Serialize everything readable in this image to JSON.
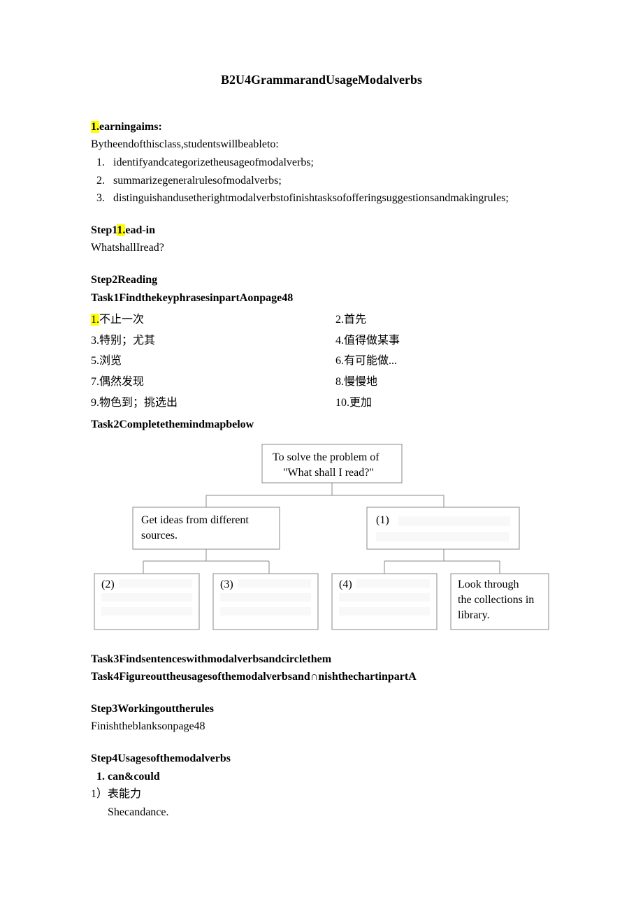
{
  "title": "B2U4GrammarandUsageModalverbs",
  "learning_aims": {
    "head_prefix": "1.",
    "head_rest": "earningaims:",
    "intro": "Bytheendofthisclass,studentswillbeableto:",
    "items": [
      "identifyandcategorizetheusageofmodalverbs;",
      "summarizegeneralrulesofmodalverbs;",
      "distinguishandusetherightmodalverbstofinishtasksofofferingsuggestionsandmakingrules;"
    ]
  },
  "step1": {
    "head_prefix": "Step1",
    "head_hl": "1.",
    "head_rest": "ead-in",
    "body": "WhatshallIread?"
  },
  "step2": {
    "head": "Step2Reading",
    "task1_head": "Task1FindthekeyphrasesinpartAonpage48",
    "phrases": [
      {
        "n_hl": "1.",
        "left": "不止一次",
        "right": "2.首先"
      },
      {
        "n_hl": "",
        "left": "3.特别；尤其",
        "right": "4.值得做某事"
      },
      {
        "n_hl": "",
        "left": "5.浏览",
        "right": "6.有可能做..."
      },
      {
        "n_hl": "",
        "left": "7.偶然发现",
        "right": "8.慢慢地"
      },
      {
        "n_hl": "",
        "left": "9.物色到；挑选出",
        "right": "10.更加"
      }
    ],
    "task2_head": "Task2Completethemindmapbelow",
    "mindmap": {
      "root_l1": "To solve the problem of",
      "root_l2": "\"What shall I read?\"",
      "left_l1": "Get ideas from different",
      "left_l2": "sources.",
      "right": "(1)",
      "b2": "(2)",
      "b3": "(3)",
      "b4": "(4)",
      "b5_l1": "Look through",
      "b5_l2": "the collections in",
      "b5_l3": "library."
    },
    "task3_head": "Task3Findsentenceswithmodalverbsandcirclethem",
    "task4_head": "Task4Figureouttheusagesofthemodalverbsand∩nishthechartinpartA"
  },
  "step3": {
    "head": "Step3Workingouttherules",
    "body": "Finishtheblanksonpage48"
  },
  "step4": {
    "head": "Step4Usagesofthemodalverbs",
    "item1": "can&could",
    "sub1": "1）表能力",
    "example": "Shecandance."
  }
}
